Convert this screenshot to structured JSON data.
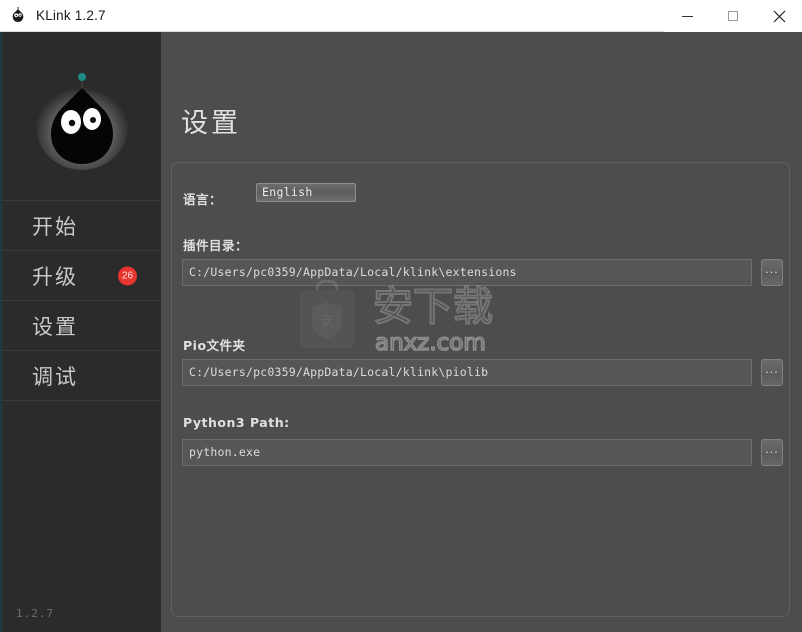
{
  "window": {
    "title": "KLink 1.2.7",
    "icon": "cat-logo-icon",
    "minimize_label": "minimize",
    "maximize_label": "maximize",
    "close_label": "close"
  },
  "sidebar": {
    "logo_alt": "klink-cat-logo",
    "items": [
      {
        "label": "开始",
        "badge": ""
      },
      {
        "label": "升级",
        "badge": "26"
      },
      {
        "label": "设置",
        "badge": ""
      },
      {
        "label": "调试",
        "badge": ""
      }
    ],
    "version": "1.2.7"
  },
  "main": {
    "page_title": "设置",
    "fields": {
      "language": {
        "label": "语言：",
        "value": "English",
        "options": [
          "English"
        ]
      },
      "extensions": {
        "label": "插件目录：",
        "value": "C:/Users/pc0359/AppData/Local/klink\\extensions",
        "browse_label": "..."
      },
      "pio_folder": {
        "label": "Pio文件夹",
        "value": "C:/Users/pc0359/AppData/Local/klink\\piolib",
        "browse_label": "..."
      },
      "python_path": {
        "label": "Python3 Path:",
        "value": "python.exe",
        "browse_label": "..."
      }
    }
  },
  "watermark": {
    "text_cn": "安下载",
    "text_domain": "anxz.com",
    "shield_glyph": "安"
  },
  "colors": {
    "sidebar_bg": "#2b2b2b",
    "content_bg": "#4d4d4d",
    "accent_edge": "#1d3b47",
    "badge_red": "#e8352e",
    "titlebar_bg": "#ffffff",
    "logo_antenna_dot": "#1f8a87"
  }
}
